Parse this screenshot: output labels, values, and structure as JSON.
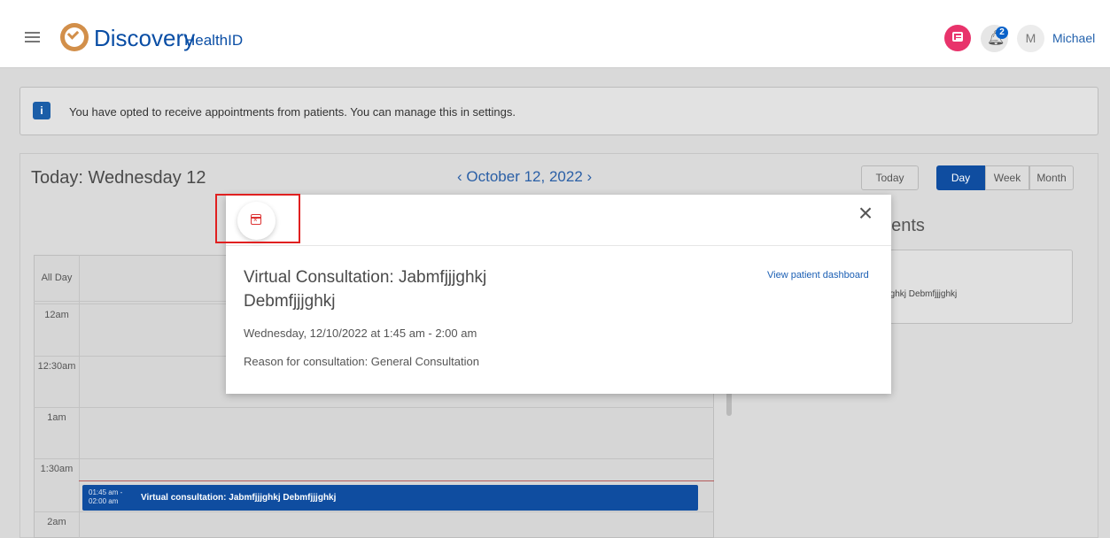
{
  "header": {
    "brand": "Discovery",
    "brand_sub": "HealthID",
    "notification_count": "2",
    "avatar_initial": "M",
    "user_name": "Michael"
  },
  "banner": {
    "text": "You have opted to receive appointments from patients. You can manage this in settings."
  },
  "calendar": {
    "today_title": "Today: Wednesday 12",
    "date_label": "October 12, 2022",
    "prev_glyph": "‹",
    "next_glyph": "›",
    "today_button": "Today",
    "views": [
      "Day",
      "Week",
      "Month"
    ],
    "active_view": "Day",
    "row_labels": [
      "All Day",
      "12am",
      "12:30am",
      "1am",
      "1:30am",
      "2am"
    ],
    "event": {
      "time_start": "01:45 am -",
      "time_end": "02:00 am",
      "title": "Virtual consultation: Jabmfjjjghkj Debmfjjjghkj"
    },
    "right_panel_title_fragment": "nents",
    "right_card_text_fragment": "jjjghkj Debmfjjjghkj"
  },
  "modal": {
    "title": "Virtual Consultation: Jabmfjjjghkj Debmfjjjghkj",
    "when": "Wednesday, 12/10/2022 at 1:45 am - 2:00 am",
    "reason": "Reason for consultation: General Consultation",
    "view_link": "View patient dashboard",
    "close_glyph": "×"
  },
  "colors": {
    "brand_blue": "#0a4ea5",
    "event_blue": "#0f4da0",
    "chat_pink": "#e8336b",
    "highlight_red": "#e02020"
  }
}
